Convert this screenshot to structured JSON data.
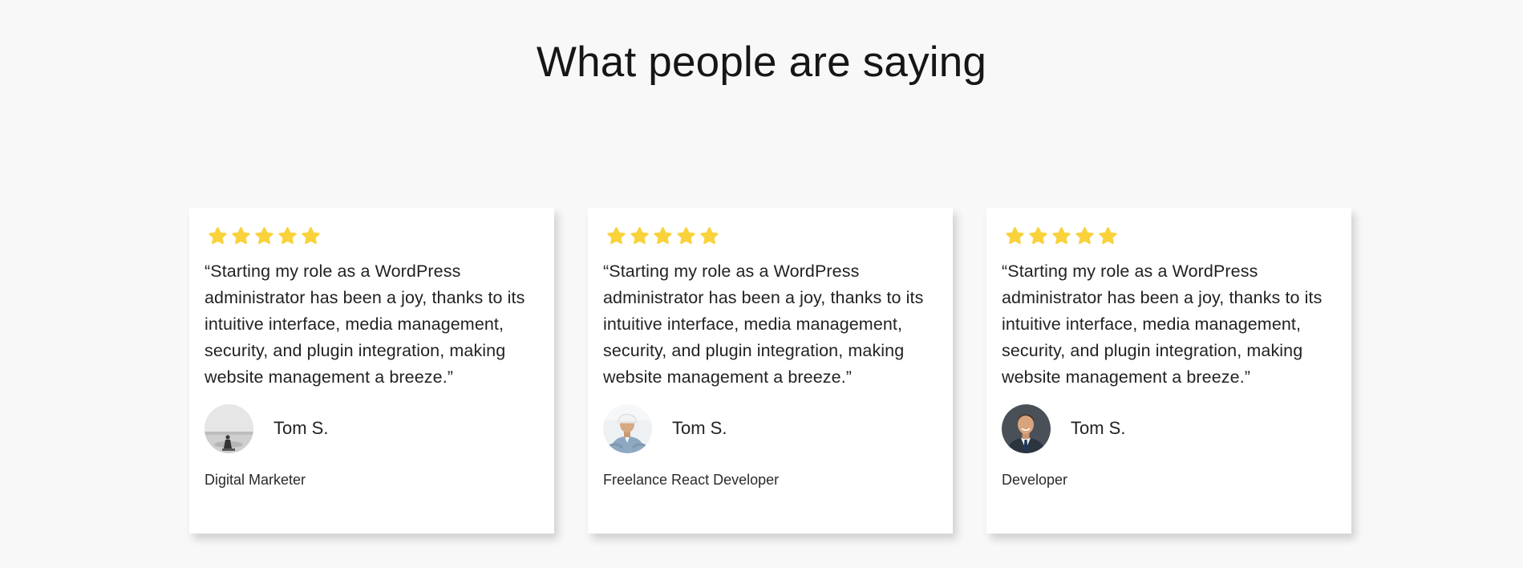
{
  "section": {
    "title": "What people are saying"
  },
  "colors": {
    "star": "#f9d23c",
    "background": "#f8f8f8",
    "card": "#ffffff"
  },
  "testimonials": [
    {
      "rating": 5,
      "quote": "“Starting my role as a WordPress administrator has been a joy, thanks to its intuitive interface, media management, security, and plugin integration, making website management a breeze.”",
      "name": "Tom S.",
      "role": "Digital Marketer",
      "avatar": "grayscale-landscape-avatar"
    },
    {
      "rating": 5,
      "quote": "“Starting my role as a WordPress administrator has been a joy, thanks to its intuitive interface, media management, security, and plugin integration, making website management a breeze.”",
      "name": "Tom S.",
      "role": "Freelance React Developer",
      "avatar": "hardhat-worker-avatar"
    },
    {
      "rating": 5,
      "quote": "“Starting my role as a WordPress administrator has been a joy, thanks to its intuitive interface, media management, security, and plugin integration, making website management a breeze.”",
      "name": "Tom S.",
      "role": "Developer",
      "avatar": "businessman-suit-avatar"
    }
  ]
}
